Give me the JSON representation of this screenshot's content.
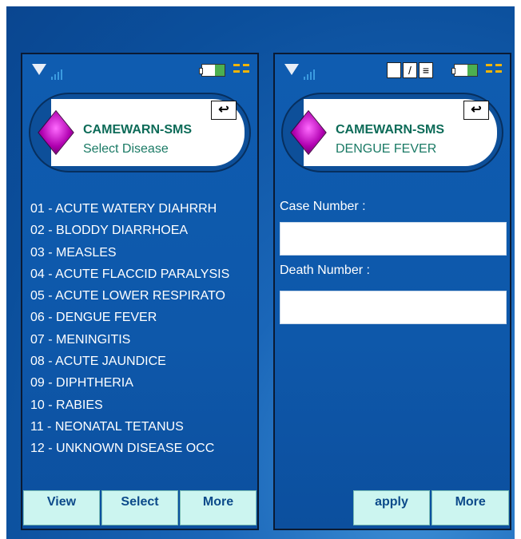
{
  "left_screen": {
    "app_title": "CAMEWARN-SMS",
    "subtitle": "Select Disease",
    "diseases": [
      "01 - ACUTE WATERY DIAHRRH",
      "02 - BLODDY DIARRHOEA",
      "03 - MEASLES",
      "04 - ACUTE FLACCID PARALYSIS",
      "05 - ACUTE LOWER RESPIRATO",
      "06 - DENGUE FEVER",
      "07 - MENINGITIS",
      "08 - ACUTE JAUNDICE",
      "09 - DIPHTHERIA",
      "10 - RABIES",
      "11 - NEONATAL TETANUS",
      "12 - UNKNOWN DISEASE OCC"
    ],
    "softkeys": [
      "View",
      "Select",
      "More"
    ]
  },
  "right_screen": {
    "app_title": "CAMEWARN-SMS",
    "subtitle": "DENGUE FEVER",
    "case_label": "Case Number :",
    "case_value": "",
    "death_label": "Death Number :",
    "death_value": "",
    "softkeys": [
      "",
      "apply",
      "More"
    ]
  },
  "icons": {
    "back": "back-arrow-icon",
    "battery": "battery-icon",
    "network": "network-icon",
    "signal": "signal-icon",
    "menu": "menu-triangle-icon",
    "app_logo": "diamond-logo-icon"
  },
  "colors": {
    "background": "#0b4f9c",
    "accent_text": "#0d6b58",
    "softkey_bg": "#ccf5f0",
    "logo": "#cc00cc"
  }
}
